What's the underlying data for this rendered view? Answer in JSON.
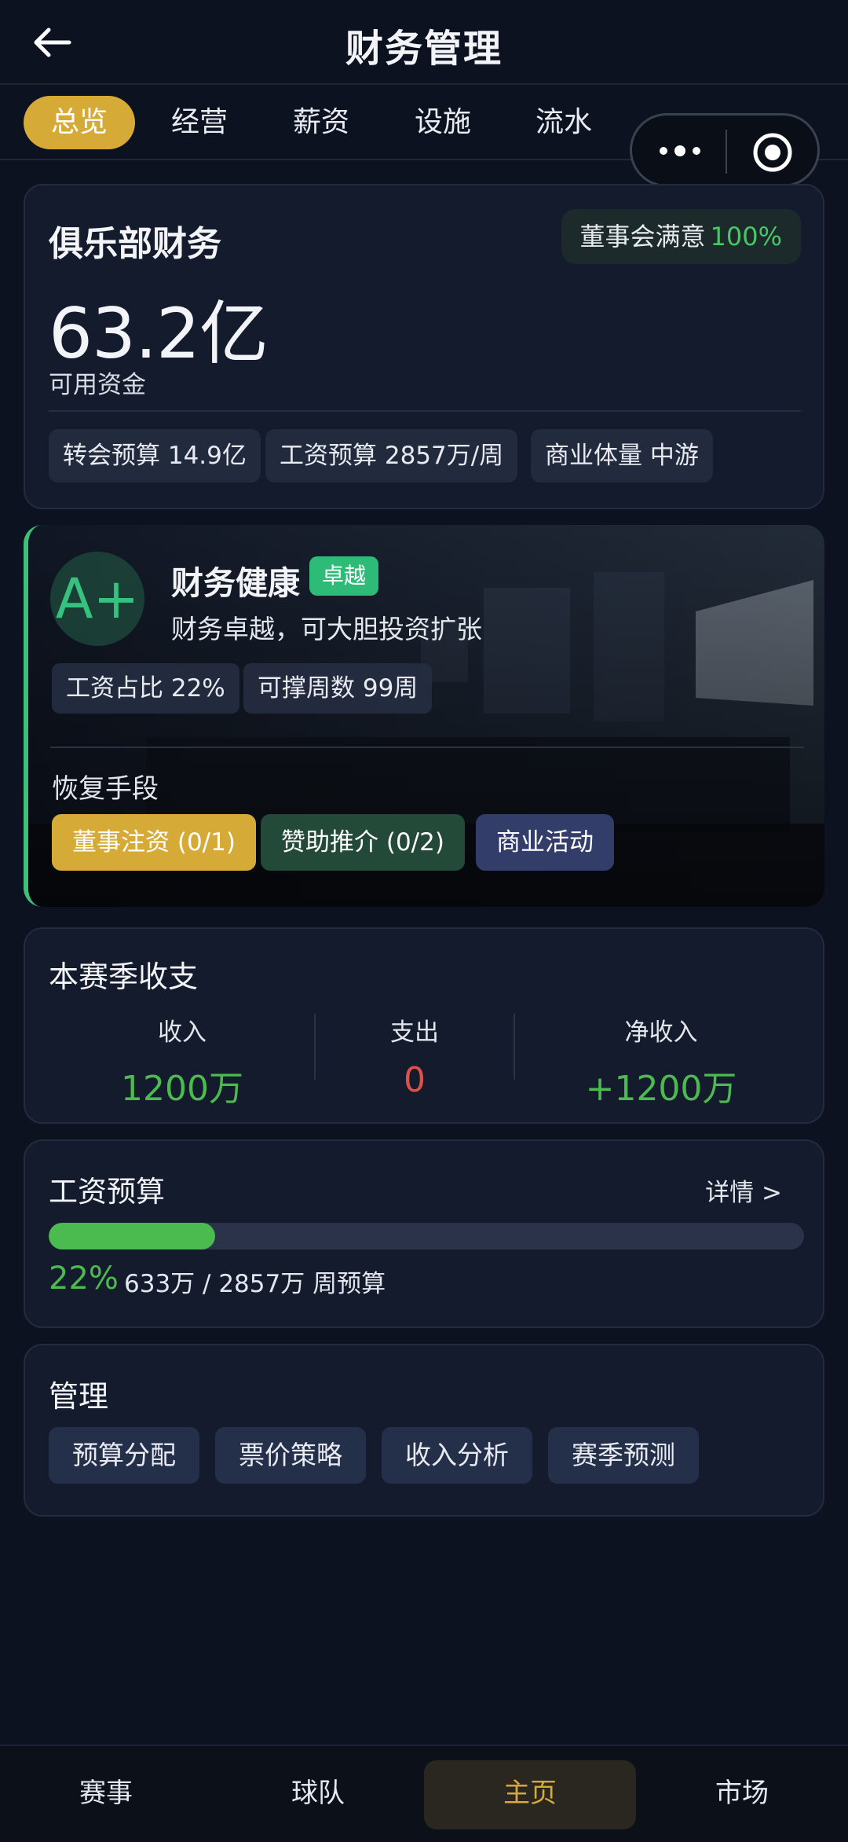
{
  "header": {
    "title": "财务管理"
  },
  "tabs": [
    {
      "label": "总览",
      "active": true
    },
    {
      "label": "经营",
      "active": false
    },
    {
      "label": "薪资",
      "active": false
    },
    {
      "label": "设施",
      "active": false
    },
    {
      "label": "流水",
      "active": false
    }
  ],
  "finance": {
    "title": "俱乐部财务",
    "board_satisfaction_label": "董事会满意",
    "board_satisfaction_value": "100%",
    "funds": "63.2亿",
    "funds_label": "可用资金",
    "chips": [
      "转会预算 14.9亿",
      "工资预算 2857万/周",
      "商业体量 中游"
    ]
  },
  "health": {
    "grade": "A+",
    "title": "财务健康",
    "badge": "卓越",
    "description": "财务卓越，可大胆投资扩张",
    "chips": [
      "工资占比 22%",
      "可撑周数 99周"
    ],
    "recovery_label": "恢复手段",
    "actions": [
      "董事注资 (0/1)",
      "赞助推介 (0/2)",
      "商业活动"
    ]
  },
  "season": {
    "title": "本赛季收支",
    "income_label": "收入",
    "income_value": "1200万",
    "expense_label": "支出",
    "expense_value": "0",
    "net_label": "净收入",
    "net_value": "+1200万"
  },
  "wage_budget": {
    "title": "工资预算",
    "detail_link": "详情 >",
    "percent_text": "22%",
    "percent": 0.22,
    "amount_text": "633万 / 2857万 周预算"
  },
  "management": {
    "title": "管理",
    "buttons": [
      "预算分配",
      "票价策略",
      "收入分析",
      "赛季预测"
    ]
  },
  "bottom_nav": [
    {
      "label": "赛事",
      "active": false
    },
    {
      "label": "球队",
      "active": false
    },
    {
      "label": "主页",
      "active": true
    },
    {
      "label": "市场",
      "active": false
    }
  ],
  "colors": {
    "accent_gold": "#d6aa36",
    "positive_green": "#4cbb4f",
    "negative_red": "#e0504a",
    "health_green": "#3ec07a"
  }
}
